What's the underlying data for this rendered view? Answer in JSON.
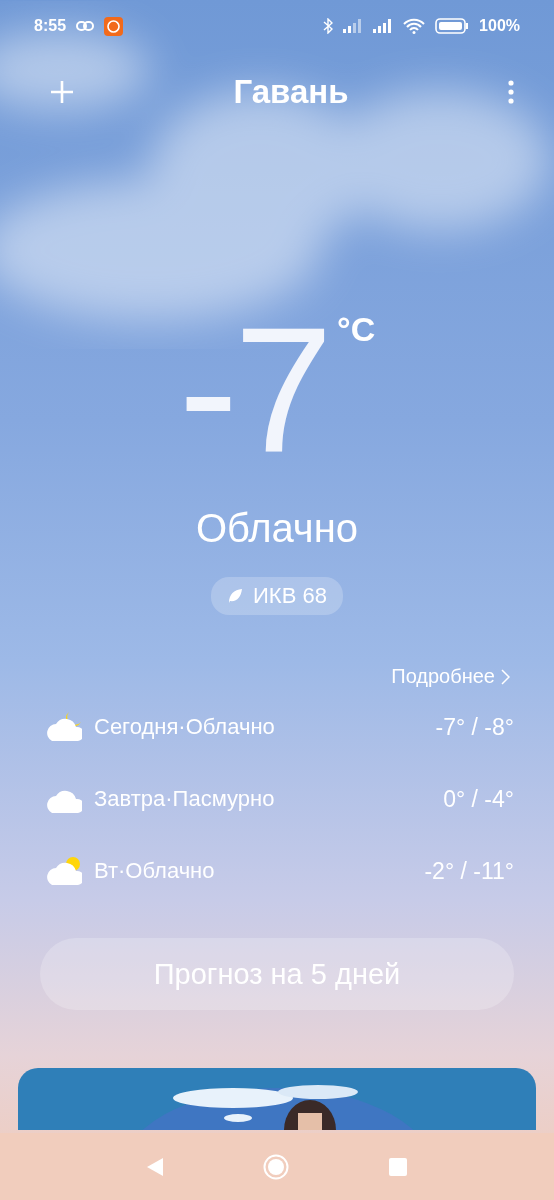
{
  "status_bar": {
    "time": "8:55",
    "battery": "100%"
  },
  "header": {
    "city": "Гавань"
  },
  "current": {
    "temperature": "-7",
    "unit": "°C",
    "condition": "Облачно",
    "aqi": "ИКВ 68"
  },
  "forecast": {
    "more_link": "Подробнее",
    "days": [
      {
        "kind": "cloudy-night",
        "label": "Сегодня·Облачно",
        "range": "-7° / -8°"
      },
      {
        "kind": "overcast",
        "label": "Завтра·Пасмурно",
        "range": "0° / -4°"
      },
      {
        "kind": "cloudy-day",
        "label": "Вт·Облачно",
        "range": "-2° / -11°"
      }
    ],
    "button": "Прогноз на 5 дней"
  }
}
